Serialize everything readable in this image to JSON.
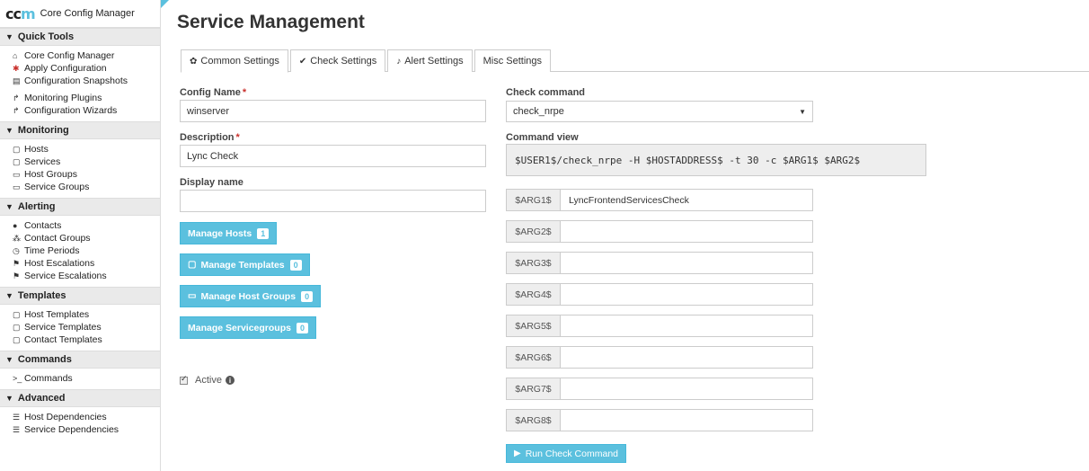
{
  "brand": {
    "logo_main": "cc",
    "logo_accent": "m",
    "title": "Core Config Manager"
  },
  "sidebar": {
    "sections": [
      {
        "title": "Quick Tools",
        "items": [
          {
            "label": "Core Config Manager",
            "icon": "home-icon"
          },
          {
            "label": "Apply Configuration",
            "icon": "asterisk-icon"
          },
          {
            "label": "Configuration Snapshots",
            "icon": "snapshot-icon"
          },
          {
            "label": "Monitoring Plugins",
            "icon": "share-icon"
          },
          {
            "label": "Configuration Wizards",
            "icon": "share-icon"
          }
        ]
      },
      {
        "title": "Monitoring",
        "items": [
          {
            "label": "Hosts",
            "icon": "file-icon"
          },
          {
            "label": "Services",
            "icon": "file-icon"
          },
          {
            "label": "Host Groups",
            "icon": "folder-icon"
          },
          {
            "label": "Service Groups",
            "icon": "folder-icon"
          }
        ]
      },
      {
        "title": "Alerting",
        "items": [
          {
            "label": "Contacts",
            "icon": "user-icon"
          },
          {
            "label": "Contact Groups",
            "icon": "users-icon"
          },
          {
            "label": "Time Periods",
            "icon": "clock-icon"
          },
          {
            "label": "Host Escalations",
            "icon": "flag-icon"
          },
          {
            "label": "Service Escalations",
            "icon": "flag-icon"
          }
        ]
      },
      {
        "title": "Templates",
        "items": [
          {
            "label": "Host Templates",
            "icon": "file-icon"
          },
          {
            "label": "Service Templates",
            "icon": "file-icon"
          },
          {
            "label": "Contact Templates",
            "icon": "file-icon"
          }
        ]
      },
      {
        "title": "Commands",
        "items": [
          {
            "label": "Commands",
            "icon": "terminal-icon"
          }
        ]
      },
      {
        "title": "Advanced",
        "items": [
          {
            "label": "Host Dependencies",
            "icon": "list-icon"
          },
          {
            "label": "Service Dependencies",
            "icon": "list-icon"
          }
        ]
      }
    ]
  },
  "page_title": "Service Management",
  "tabs": [
    {
      "label": "Common Settings",
      "icon": "gear-icon"
    },
    {
      "label": "Check Settings",
      "icon": "check-icon"
    },
    {
      "label": "Alert Settings",
      "icon": "bell-icon"
    },
    {
      "label": "Misc Settings",
      "icon": ""
    }
  ],
  "form": {
    "config_name_label": "Config Name",
    "config_name_value": "winserver",
    "description_label": "Description",
    "description_value": "Lync Check",
    "display_name_label": "Display name",
    "display_name_value": "",
    "required_mark": "*",
    "buttons": {
      "manage_hosts": {
        "label": "Manage Hosts",
        "count": "1"
      },
      "manage_templates": {
        "label": "Manage Templates",
        "count": "0"
      },
      "manage_host_groups": {
        "label": "Manage Host Groups",
        "count": "0"
      },
      "manage_servicegroups": {
        "label": "Manage Servicegroups",
        "count": "0"
      }
    },
    "active_label": "Active",
    "active_checked": true
  },
  "check": {
    "check_command_label": "Check command",
    "check_command_value": "check_nrpe",
    "command_view_label": "Command view",
    "command_view_value": "$USER1$/check_nrpe -H $HOSTADDRESS$ -t 30 -c $ARG1$ $ARG2$",
    "args": [
      {
        "name": "$ARG1$",
        "value": "LyncFrontendServicesCheck"
      },
      {
        "name": "$ARG2$",
        "value": ""
      },
      {
        "name": "$ARG3$",
        "value": ""
      },
      {
        "name": "$ARG4$",
        "value": ""
      },
      {
        "name": "$ARG5$",
        "value": ""
      },
      {
        "name": "$ARG6$",
        "value": ""
      },
      {
        "name": "$ARG7$",
        "value": ""
      },
      {
        "name": "$ARG8$",
        "value": ""
      }
    ],
    "run_button_label": "Run Check Command"
  },
  "colors": {
    "accent": "#5bc0de",
    "required": "#c9302c"
  }
}
